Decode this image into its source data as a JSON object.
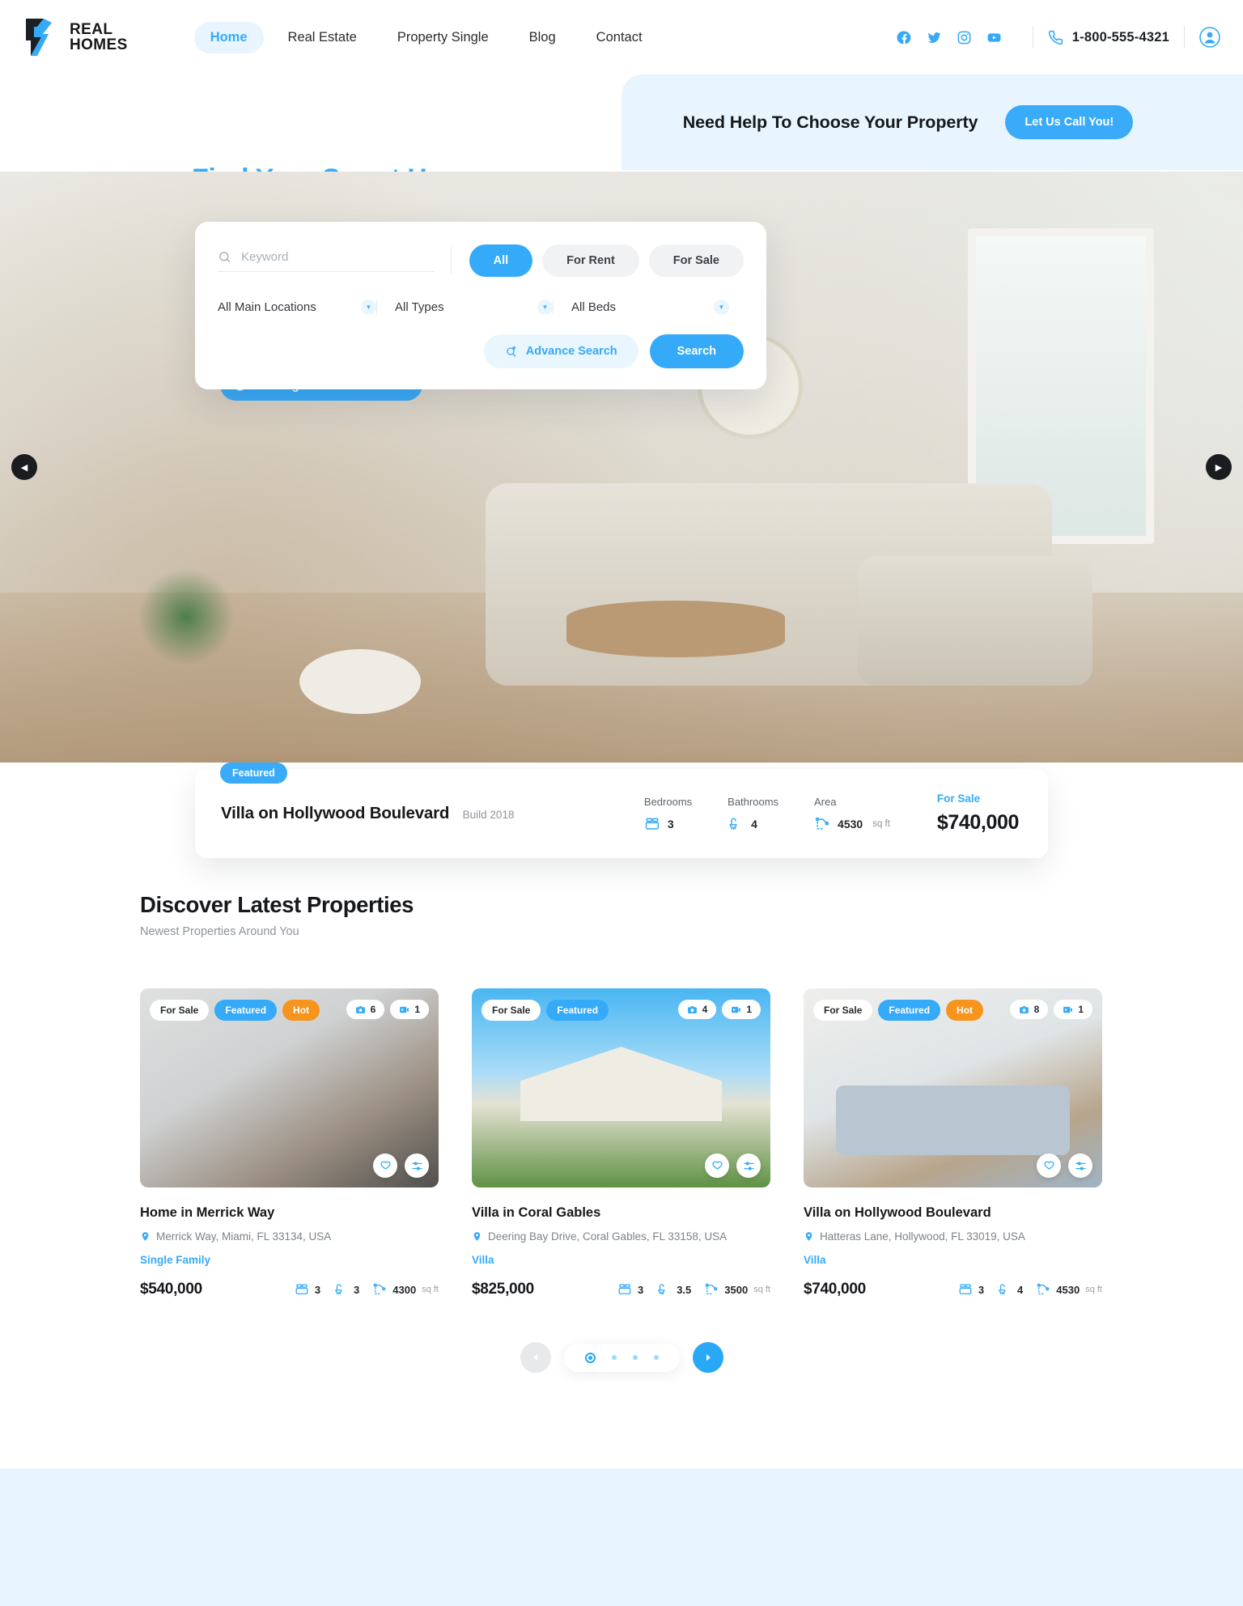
{
  "brand": {
    "name_line1": "REAL",
    "name_line2": "HOMES",
    "logo_icon": "real-homes-logo",
    "accent": "#34aaf9"
  },
  "nav": {
    "items": [
      {
        "label": "Home",
        "active": true
      },
      {
        "label": "Real Estate",
        "active": false
      },
      {
        "label": "Property Single",
        "active": false
      },
      {
        "label": "Blog",
        "active": false
      },
      {
        "label": "Contact",
        "active": false
      }
    ]
  },
  "header": {
    "socials": [
      {
        "name": "facebook-icon"
      },
      {
        "name": "twitter-icon"
      },
      {
        "name": "instagram-icon"
      },
      {
        "name": "youtube-icon"
      }
    ],
    "phone_icon": "phone-icon",
    "phone": "1-800-555-4321",
    "account_icon": "user-account-icon"
  },
  "hero": {
    "title": "Find Your Sweet Home",
    "need_help_text": "Need Help To Choose Your Property",
    "call_button": "Let Us Call You!",
    "features_pill": "Looking for certain features",
    "features_pill_icon": "plus-circle-icon",
    "prev_icon": "chevron-left-icon",
    "next_icon": "chevron-right-icon"
  },
  "search": {
    "keyword_placeholder": "Keyword",
    "keyword_value": "",
    "search_icon": "search-icon",
    "tabs": [
      {
        "label": "All",
        "active": true
      },
      {
        "label": "For Rent",
        "active": false
      },
      {
        "label": "For Sale",
        "active": false
      }
    ],
    "selects": [
      {
        "label": "All Main Locations",
        "name": "location-select"
      },
      {
        "label": "All Types",
        "name": "type-select"
      },
      {
        "label": "All Beds",
        "name": "beds-select"
      }
    ],
    "advance_label": "Advance Search",
    "advance_icon": "search-plus-icon",
    "search_label": "Search"
  },
  "featured_property": {
    "tag": "Featured",
    "title": "Villa on Hollywood Boulevard",
    "build": "Build 2018",
    "stats": [
      {
        "heading": "Bedrooms",
        "value": "3",
        "icon": "bed-icon"
      },
      {
        "heading": "Bathrooms",
        "value": "4",
        "icon": "shower-icon"
      },
      {
        "heading": "Area",
        "value": "4530",
        "unit": "sq ft",
        "icon": "area-icon"
      }
    ],
    "status": "For Sale",
    "price": "$740,000"
  },
  "latest": {
    "title": "Discover Latest Properties",
    "subtitle": "Newest Properties Around You",
    "cards": [
      {
        "title": "Home in Merrick Way",
        "address": "Merrick Way, Miami, FL 33134, USA",
        "type": "Single Family",
        "price": "$540,000",
        "badges": [
          {
            "label": "For Sale",
            "style": "sale"
          },
          {
            "label": "Featured",
            "style": "featured"
          },
          {
            "label": "Hot",
            "style": "hot"
          }
        ],
        "photos": "6",
        "videos": "1",
        "beds": "3",
        "baths": "3",
        "area": "4300",
        "area_unit": "sq ft"
      },
      {
        "title": "Villa in Coral Gables",
        "address": "Deering Bay Drive, Coral Gables, FL 33158, USA",
        "type": "Villa",
        "price": "$825,000",
        "badges": [
          {
            "label": "For Sale",
            "style": "sale"
          },
          {
            "label": "Featured",
            "style": "featured"
          }
        ],
        "photos": "4",
        "videos": "1",
        "beds": "3",
        "baths": "3.5",
        "area": "3500",
        "area_unit": "sq ft"
      },
      {
        "title": "Villa on Hollywood Boulevard",
        "address": "Hatteras Lane, Hollywood, FL 33019, USA",
        "type": "Villa",
        "price": "$740,000",
        "badges": [
          {
            "label": "For Sale",
            "style": "sale"
          },
          {
            "label": "Featured",
            "style": "featured"
          },
          {
            "label": "Hot",
            "style": "hot"
          }
        ],
        "photos": "8",
        "videos": "1",
        "beds": "3",
        "baths": "4",
        "area": "4530",
        "area_unit": "sq ft"
      }
    ],
    "carousel": {
      "dots": 4,
      "active_dot": 0,
      "prev_icon": "carousel-prev-icon",
      "next_icon": "carousel-next-icon"
    },
    "card_action_icons": {
      "favorite": "heart-icon",
      "compare": "compare-sliders-icon"
    },
    "counter_icons": {
      "photos": "camera-icon",
      "videos": "video-icon"
    },
    "address_icon": "map-pin-icon"
  }
}
